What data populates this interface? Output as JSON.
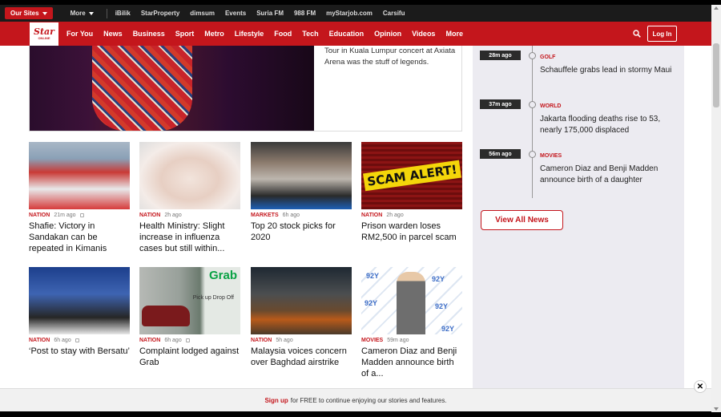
{
  "topbar": {
    "our_sites": "Our Sites",
    "more": "More",
    "links": [
      "iBilik",
      "StarProperty",
      "dimsum",
      "Events",
      "Suria FM",
      "988 FM",
      "myStarjob.com",
      "Carsifu"
    ]
  },
  "nav": {
    "logo_main": "Star",
    "logo_sub": "ONLINE",
    "items": [
      "For You",
      "News",
      "Business",
      "Sport",
      "Metro",
      "Lifestyle",
      "Food",
      "Tech",
      "Education",
      "Opinion",
      "Videos",
      "More"
    ],
    "login": "Log In"
  },
  "hero": {
    "text": "Tour in Kuala Lumpur concert at Axiata Arena was the stuff of legends."
  },
  "articles": [
    {
      "category": "NATION",
      "time": "21m ago",
      "title": "Shafie: Victory in Sandakan can be repeated in Kimanis"
    },
    {
      "category": "NATION",
      "time": "2h ago",
      "title": "Health Ministry: Slight increase in influenza cases but still within..."
    },
    {
      "category": "MARKETS",
      "time": "6h ago",
      "title": "Top 20 stock picks for 2020"
    },
    {
      "category": "NATION",
      "time": "2h ago",
      "title": "Prison warden loses RM2,500 in parcel scam",
      "image_text": "SCAM ALERT!"
    },
    {
      "category": "NATION",
      "time": "6h ago",
      "title": "‘Post to stay with Bersatu’"
    },
    {
      "category": "NATION",
      "time": "6h ago",
      "title": "Complaint lodged against Grab",
      "image_logo": "Grab",
      "image_sign": "Pick up Drop Off"
    },
    {
      "category": "NATION",
      "time": "5h ago",
      "title": "Malaysia voices concern over Baghdad airstrike"
    },
    {
      "category": "MOVIES",
      "time": "59m ago",
      "title": "Cameron Diaz and Benji Madden announce birth of a..."
    }
  ],
  "timeline": [
    {
      "time": "28m ago",
      "category": "GOLF",
      "title": "Schauffele grabs lead in stormy Maui"
    },
    {
      "time": "37m ago",
      "category": "WORLD",
      "title": "Jakarta flooding deaths rise to 53, nearly 175,000 displaced"
    },
    {
      "time": "56m ago",
      "category": "MOVIES",
      "title": "Cameron Diaz and Benji Madden announce birth of a daughter"
    }
  ],
  "view_all": "View All News",
  "signup": {
    "link": "Sign up",
    "text": "for FREE to continue enjoying our stories and features."
  },
  "colors": {
    "brand_red": "#c4161c",
    "topbar": "#1b1b1b",
    "sidebar_bg": "#ecebf1"
  },
  "icons": {
    "search": "search-icon",
    "close": "close-icon",
    "lock": "lock-icon"
  }
}
